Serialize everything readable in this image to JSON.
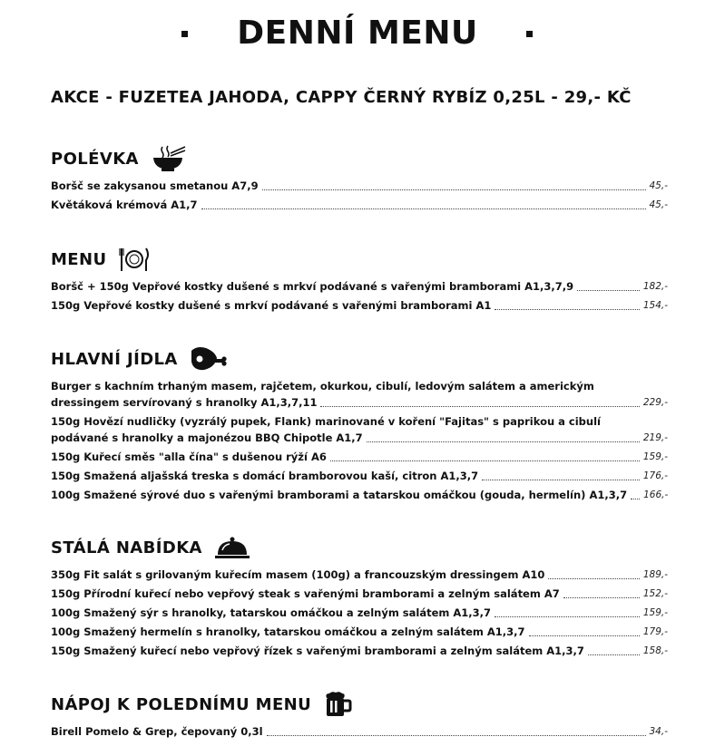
{
  "header": {
    "title": "DENNÍ MENU"
  },
  "promo": {
    "text": "AKCE - FUZETEA JAHODA, CAPPY ČERNÝ RYBÍZ 0,25L - 29,- KČ"
  },
  "sections": {
    "polevka": {
      "title": "POLÉVKA",
      "icon": "soup-bowl-icon",
      "items": [
        {
          "name": "Boršč se zakysanou smetanou A7,9",
          "price": "45,-"
        },
        {
          "name": "Květáková krémová A1,7",
          "price": "45,-"
        }
      ]
    },
    "menu": {
      "title": "MENU",
      "icon": "plate-cutlery-icon",
      "items": [
        {
          "name": "Boršč + 150g Vepřové kostky dušené s mrkví podávané s vařenými bramborami A1,3,7,9",
          "price": "182,-"
        },
        {
          "name": "150g Vepřové kostky dušené s mrkví podávané s vařenými bramborami A1",
          "price": "154,-"
        }
      ]
    },
    "hlavni": {
      "title": "HLAVNÍ JÍDLA",
      "icon": "ham-leg-icon",
      "items": [
        {
          "line1": "Burger s kachním trhaným masem, rajčetem, okurkou, cibulí, ledovým salátem a americkým",
          "name": "dressingem servírovaný s hranolky A1,3,7,11",
          "price": "229,-"
        },
        {
          "line1": "150g Hovězí nudličky (vyzrálý pupek, Flank) marinované v koření \"Fajitas\" s paprikou a cibulí",
          "name": "podávané s hranolky a majonézou BBQ Chipotle A1,7",
          "price": "219,-"
        },
        {
          "name": "150g Kuřecí směs \"alla čína\" s dušenou rýží A6",
          "price": "159,-"
        },
        {
          "name": "150g Smažená aljašská treska s domácí bramborovou kaší, citron A1,3,7",
          "price": "176,-"
        },
        {
          "name": "100g Smažené sýrové duo s vařenými bramborami a tatarskou omáčkou (gouda, hermelín) A1,3,7",
          "price": "166,-"
        }
      ]
    },
    "stala": {
      "title": "STÁLÁ NABÍDKA",
      "icon": "cloche-icon",
      "items": [
        {
          "name": "350g Fit salát s grilovaným kuřecím masem (100g) a francouzským dressingem A10",
          "price": "189,-"
        },
        {
          "name": "150g Přírodní kuřecí nebo vepřový steak s vařenými bramborami a zelným salátem A7",
          "price": "152,-"
        },
        {
          "name": "100g Smažený sýr s hranolky, tatarskou omáčkou a zelným salátem A1,3,7",
          "price": "159,-"
        },
        {
          "name": "100g Smažený hermelín s hranolky, tatarskou omáčkou a zelným salátem A1,3,7",
          "price": "179,-"
        },
        {
          "name": "150g Smažený kuřecí nebo vepřový řízek s vařenými bramborami a zelným salátem A1,3,7",
          "price": "158,-"
        }
      ]
    },
    "napoj": {
      "title": "NÁPOJ K POLEDNÍMU MENU",
      "icon": "beer-mug-icon",
      "items": [
        {
          "name": "Birell Pomelo & Grep, čepovaný 0,3l",
          "price": "34,-"
        }
      ]
    }
  }
}
